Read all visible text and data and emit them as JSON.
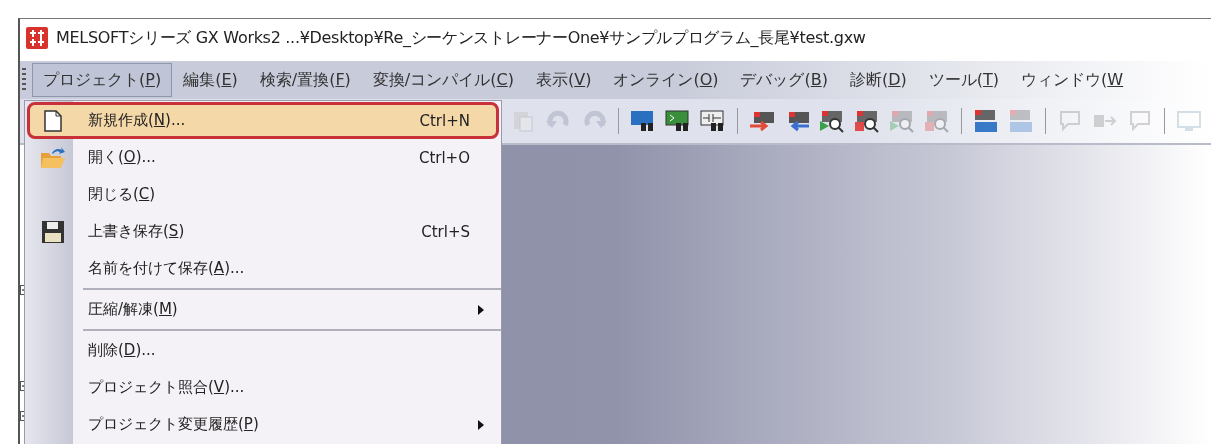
{
  "window": {
    "title": "MELSOFTシリーズ GX Works2 ...¥Desktop¥Re_シーケンストレーナーOne¥サンプルプログラム_長尾¥test.gxw"
  },
  "menu_bar": [
    {
      "before": "プロジェクト(",
      "mnemonic": "P",
      "after": ")",
      "selected": true
    },
    {
      "before": "編集(",
      "mnemonic": "E",
      "after": ")",
      "selected": false
    },
    {
      "before": "検索/置換(",
      "mnemonic": "F",
      "after": ")",
      "selected": false
    },
    {
      "before": "変換/コンパイル(",
      "mnemonic": "C",
      "after": ")",
      "selected": false
    },
    {
      "before": "表示(",
      "mnemonic": "V",
      "after": ")",
      "selected": false
    },
    {
      "before": "オンライン(",
      "mnemonic": "O",
      "after": ")",
      "selected": false
    },
    {
      "before": "デバッグ(",
      "mnemonic": "B",
      "after": ")",
      "selected": false
    },
    {
      "before": "診断(",
      "mnemonic": "D",
      "after": ")",
      "selected": false
    },
    {
      "before": "ツール(",
      "mnemonic": "T",
      "after": ")",
      "selected": false
    },
    {
      "before": "ウィンドウ(",
      "mnemonic": "W",
      "selected": false
    }
  ],
  "toolbar": [
    {
      "kind": "paste",
      "disabled": true
    },
    {
      "kind": "undo",
      "disabled": true
    },
    {
      "kind": "redo",
      "disabled": true
    },
    {
      "kind": "separator"
    },
    {
      "kind": "device-search",
      "disabled": false
    },
    {
      "kind": "instruction-search",
      "disabled": false
    },
    {
      "kind": "contact-search",
      "disabled": false
    },
    {
      "kind": "separator"
    },
    {
      "kind": "write",
      "disabled": false
    },
    {
      "kind": "read",
      "disabled": false
    },
    {
      "kind": "monitor-start",
      "disabled": false
    },
    {
      "kind": "monitor-stop",
      "disabled": false
    },
    {
      "kind": "monitor-start",
      "disabled": true
    },
    {
      "kind": "monitor-stop",
      "disabled": true
    },
    {
      "kind": "separator"
    },
    {
      "kind": "device-monitor",
      "disabled": false
    },
    {
      "kind": "device-test",
      "disabled": true
    },
    {
      "kind": "separator"
    },
    {
      "kind": "comment",
      "disabled": true
    },
    {
      "kind": "transfer",
      "disabled": true
    },
    {
      "kind": "comment",
      "disabled": true
    },
    {
      "kind": "separator"
    },
    {
      "kind": "screen",
      "disabled": true
    }
  ],
  "project_menu": [
    {
      "before": "新規作成(",
      "mnemonic": "N",
      "after": ")...",
      "shortcut": "Ctrl+N",
      "selected": true
    },
    {
      "before": "開く(",
      "mnemonic": "O",
      "after": ")...",
      "shortcut": "Ctrl+O",
      "selected": false
    },
    {
      "before": "閉じる(",
      "mnemonic": "C",
      "after": ")",
      "selected": false
    },
    {
      "before": "上書き保存(",
      "mnemonic": "S",
      "after": ")",
      "shortcut": "Ctrl+S",
      "selected": false
    },
    {
      "before": "名前を付けて保存(",
      "mnemonic": "A",
      "after": ")...",
      "selected": false
    },
    {
      "before": "圧縮/解凍(",
      "mnemonic": "M",
      "after": ")",
      "submenu": true,
      "separator_before": true,
      "selected": false
    },
    {
      "before": "削除(",
      "mnemonic": "D",
      "after": ")...",
      "separator_before": true,
      "selected": false
    },
    {
      "before": "プロジェクト照合(",
      "mnemonic": "V",
      "after": ")...",
      "selected": false
    },
    {
      "before": "プロジェクト変更履歴(",
      "mnemonic": "P",
      "after": ")",
      "submenu": true,
      "selected": false
    }
  ]
}
